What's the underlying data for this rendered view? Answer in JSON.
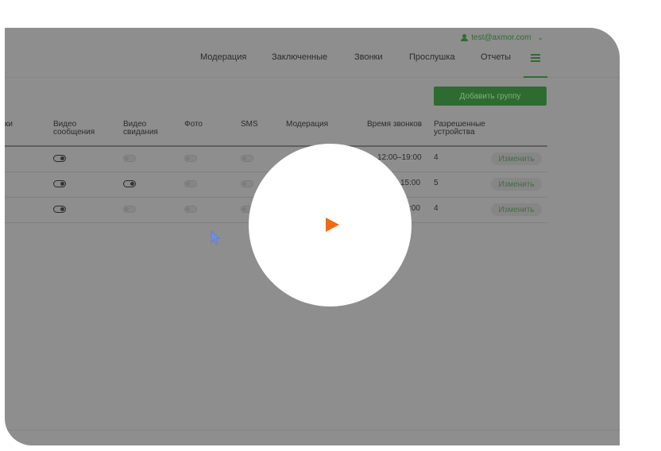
{
  "header": {
    "user_email": "test@axmor.com",
    "user_icon": "user-icon",
    "dropdown_icon": "chevron-down-icon",
    "nav": [
      "Модерация",
      "Заключенные",
      "Звонки",
      "Прослушка",
      "Отчеты"
    ],
    "menu_icon": "hamburger-menu-icon"
  },
  "toolbar": {
    "add_group_label": "Добавить группу"
  },
  "table": {
    "columns": [
      "ки",
      "Видео сообщения",
      "Видео свидания",
      "Фото",
      "SMS",
      "Модерация",
      "Время звонков",
      "Разрешенные устройства"
    ],
    "columns_split": {
      "video_messages": [
        "Видео",
        "сообщения"
      ],
      "video_visits": [
        "Видео",
        "свидания"
      ],
      "allowed_devices": [
        "Разрешенные",
        "устройства"
      ]
    },
    "rows": [
      {
        "video_messages": true,
        "video_visits": false,
        "photo": false,
        "sms": false,
        "call_time": "12:00–19:00",
        "devices": "4",
        "action": "Изменить"
      },
      {
        "video_messages": true,
        "video_visits": true,
        "photo": false,
        "sms": false,
        "call_time": "15:00",
        "devices": "5",
        "action": "Изменить"
      },
      {
        "video_messages": true,
        "video_visits": false,
        "photo": false,
        "sms": false,
        "call_time": ":00",
        "devices": "4",
        "action": "Изменить"
      }
    ]
  },
  "overlay": {
    "play_icon": "play-icon",
    "play_color": "#ef6a16"
  },
  "colors": {
    "accent": "#2e6b31",
    "overlay_gray": "#8e8e8e"
  }
}
